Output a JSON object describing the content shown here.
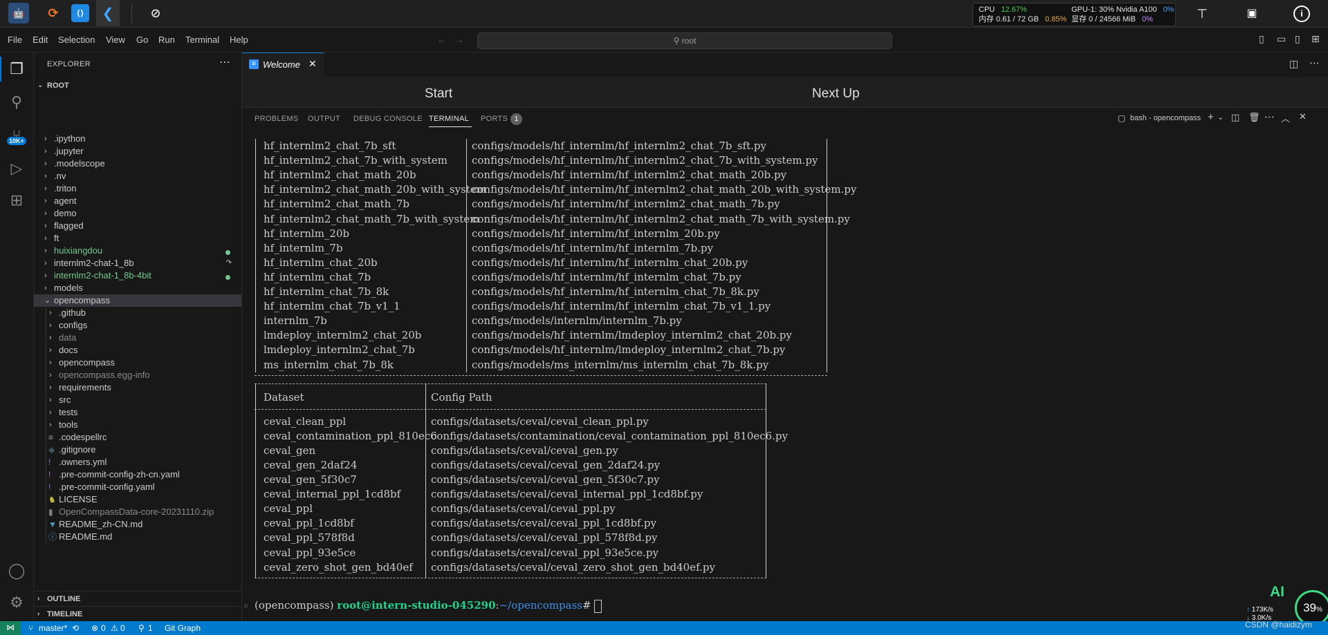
{
  "topbar": {
    "perf": {
      "cpu_label": "CPU",
      "cpu_value": "12.67%",
      "mem_label": "内存 0.61 / 72 GB",
      "mem_value": "0.85%",
      "gpu_label": "GPU-1: 30% Nvidia A100",
      "gpu_value": "0%",
      "vram_label": "显存 0 / 24566 MiB",
      "vram_value": "0%"
    }
  },
  "menubar": {
    "items": [
      "File",
      "Edit",
      "Selection",
      "View",
      "Go",
      "Run",
      "Terminal",
      "Help"
    ],
    "search_text": "root"
  },
  "activity": {
    "badge": "10K+"
  },
  "explorer": {
    "title": "EXPLORER",
    "root": "ROOT",
    "items": [
      {
        "label": ".ipython",
        "kind": "folder",
        "depth": 1,
        "color": "#cccccc"
      },
      {
        "label": ".jupyter",
        "kind": "folder",
        "depth": 1,
        "color": "#cccccc"
      },
      {
        "label": ".modelscope",
        "kind": "folder",
        "depth": 1,
        "color": "#cccccc"
      },
      {
        "label": ".nv",
        "kind": "folder",
        "depth": 1,
        "color": "#cccccc"
      },
      {
        "label": ".triton",
        "kind": "folder",
        "depth": 1,
        "color": "#cccccc"
      },
      {
        "label": "agent",
        "kind": "folder",
        "depth": 1,
        "color": "#cccccc"
      },
      {
        "label": "demo",
        "kind": "folder",
        "depth": 1,
        "color": "#cccccc"
      },
      {
        "label": "flagged",
        "kind": "folder",
        "depth": 1,
        "color": "#cccccc"
      },
      {
        "label": "ft",
        "kind": "folder",
        "depth": 1,
        "color": "#cccccc"
      },
      {
        "label": "huixiangdou",
        "kind": "folder",
        "depth": 1,
        "color": "#73c991",
        "dot": true
      },
      {
        "label": "internlm2-chat-1_8b",
        "kind": "folder",
        "depth": 1,
        "color": "#cccccc",
        "link": true
      },
      {
        "label": "internlm2-chat-1_8b-4bit",
        "kind": "folder",
        "depth": 1,
        "color": "#73c991",
        "dot": true
      },
      {
        "label": "models",
        "kind": "folder",
        "depth": 1,
        "color": "#cccccc"
      },
      {
        "label": "opencompass",
        "kind": "folder-open",
        "depth": 1,
        "color": "#cccccc"
      },
      {
        "label": ".github",
        "kind": "folder",
        "depth": 2,
        "color": "#cccccc"
      },
      {
        "label": "configs",
        "kind": "folder",
        "depth": 2,
        "color": "#cccccc"
      },
      {
        "label": "data",
        "kind": "folder",
        "depth": 2,
        "color": "#8b8b8b"
      },
      {
        "label": "docs",
        "kind": "folder",
        "depth": 2,
        "color": "#cccccc"
      },
      {
        "label": "opencompass",
        "kind": "folder",
        "depth": 2,
        "color": "#cccccc"
      },
      {
        "label": "opencompass.egg-info",
        "kind": "folder",
        "depth": 2,
        "color": "#8b8b8b"
      },
      {
        "label": "requirements",
        "kind": "folder",
        "depth": 2,
        "color": "#cccccc"
      },
      {
        "label": "src",
        "kind": "folder",
        "depth": 2,
        "color": "#cccccc"
      },
      {
        "label": "tests",
        "kind": "folder",
        "depth": 2,
        "color": "#cccccc"
      },
      {
        "label": "tools",
        "kind": "folder",
        "depth": 2,
        "color": "#cccccc"
      },
      {
        "label": ".codespellrc",
        "kind": "file",
        "depth": 2,
        "color": "#cccccc",
        "icon": "≡",
        "iconColor": "#9d9d9d"
      },
      {
        "label": ".gitignore",
        "kind": "file",
        "depth": 2,
        "color": "#cccccc",
        "icon": "◆",
        "iconColor": "#41535b"
      },
      {
        "label": ".owners.yml",
        "kind": "file",
        "depth": 2,
        "color": "#cccccc",
        "icon": "!",
        "iconColor": "#a074c4"
      },
      {
        "label": ".pre-commit-config-zh-cn.yaml",
        "kind": "file",
        "depth": 2,
        "color": "#cccccc",
        "icon": "!",
        "iconColor": "#a074c4"
      },
      {
        "label": ".pre-commit-config.yaml",
        "kind": "file",
        "depth": 2,
        "color": "#cccccc",
        "icon": "!",
        "iconColor": "#a074c4"
      },
      {
        "label": "LICENSE",
        "kind": "file",
        "depth": 2,
        "color": "#cccccc",
        "icon": "♞",
        "iconColor": "#cbcb41"
      },
      {
        "label": "OpenCompassData-core-20231110.zip",
        "kind": "file",
        "depth": 2,
        "color": "#8b8b8b",
        "icon": "▮",
        "iconColor": "#7f7f7f"
      },
      {
        "label": "README_zh-CN.md",
        "kind": "file",
        "depth": 2,
        "color": "#cccccc",
        "icon": "▼",
        "iconColor": "#519aba"
      },
      {
        "label": "README.md",
        "kind": "file",
        "depth": 2,
        "color": "#cccccc",
        "icon": "ⓘ",
        "iconColor": "#519aba"
      }
    ],
    "outline": "OUTLINE",
    "timeline": "TIMELINE"
  },
  "editor": {
    "tab_label": "Welcome",
    "start_heading": "Start",
    "next_heading": "Next Up"
  },
  "panel": {
    "tabs": [
      "PROBLEMS",
      "OUTPUT",
      "DEBUG CONSOLE",
      "TERMINAL",
      "PORTS"
    ],
    "ports_badge": "1",
    "terminal_name": "bash - opencompass"
  },
  "terminal": {
    "models": [
      [
        "hf_internlm2_chat_7b_sft",
        "configs/models/hf_internlm/hf_internlm2_chat_7b_sft.py"
      ],
      [
        "hf_internlm2_chat_7b_with_system",
        "configs/models/hf_internlm/hf_internlm2_chat_7b_with_system.py"
      ],
      [
        "hf_internlm2_chat_math_20b",
        "configs/models/hf_internlm/hf_internlm2_chat_math_20b.py"
      ],
      [
        "hf_internlm2_chat_math_20b_with_system",
        "configs/models/hf_internlm/hf_internlm2_chat_math_20b_with_system.py"
      ],
      [
        "hf_internlm2_chat_math_7b",
        "configs/models/hf_internlm/hf_internlm2_chat_math_7b.py"
      ],
      [
        "hf_internlm2_chat_math_7b_with_system",
        "configs/models/hf_internlm/hf_internlm2_chat_math_7b_with_system.py"
      ],
      [
        "hf_internlm_20b",
        "configs/models/hf_internlm/hf_internlm_20b.py"
      ],
      [
        "hf_internlm_7b",
        "configs/models/hf_internlm/hf_internlm_7b.py"
      ],
      [
        "hf_internlm_chat_20b",
        "configs/models/hf_internlm/hf_internlm_chat_20b.py"
      ],
      [
        "hf_internlm_chat_7b",
        "configs/models/hf_internlm/hf_internlm_chat_7b.py"
      ],
      [
        "hf_internlm_chat_7b_8k",
        "configs/models/hf_internlm/hf_internlm_chat_7b_8k.py"
      ],
      [
        "hf_internlm_chat_7b_v1_1",
        "configs/models/hf_internlm/hf_internlm_chat_7b_v1_1.py"
      ],
      [
        "internlm_7b",
        "configs/models/internlm/internlm_7b.py"
      ],
      [
        "lmdeploy_internlm2_chat_20b",
        "configs/models/hf_internlm/lmdeploy_internlm2_chat_20b.py"
      ],
      [
        "lmdeploy_internlm2_chat_7b",
        "configs/models/hf_internlm/lmdeploy_internlm2_chat_7b.py"
      ],
      [
        "ms_internlm_chat_7b_8k",
        "configs/models/ms_internlm/ms_internlm_chat_7b_8k.py"
      ]
    ],
    "dataset_header": [
      "Dataset",
      "Config Path"
    ],
    "datasets": [
      [
        "ceval_clean_ppl",
        "configs/datasets/ceval/ceval_clean_ppl.py"
      ],
      [
        "ceval_contamination_ppl_810ec6",
        "configs/datasets/contamination/ceval_contamination_ppl_810ec6.py"
      ],
      [
        "ceval_gen",
        "configs/datasets/ceval/ceval_gen.py"
      ],
      [
        "ceval_gen_2daf24",
        "configs/datasets/ceval/ceval_gen_2daf24.py"
      ],
      [
        "ceval_gen_5f30c7",
        "configs/datasets/ceval/ceval_gen_5f30c7.py"
      ],
      [
        "ceval_internal_ppl_1cd8bf",
        "configs/datasets/ceval/ceval_internal_ppl_1cd8bf.py"
      ],
      [
        "ceval_ppl",
        "configs/datasets/ceval/ceval_ppl.py"
      ],
      [
        "ceval_ppl_1cd8bf",
        "configs/datasets/ceval/ceval_ppl_1cd8bf.py"
      ],
      [
        "ceval_ppl_578f8d",
        "configs/datasets/ceval/ceval_ppl_578f8d.py"
      ],
      [
        "ceval_ppl_93e5ce",
        "configs/datasets/ceval/ceval_ppl_93e5ce.py"
      ],
      [
        "ceval_zero_shot_gen_bd40ef",
        "configs/datasets/ceval/ceval_zero_shot_gen_bd40ef.py"
      ]
    ],
    "prompt_env": "(opencompass)",
    "prompt_user": "root@intern-studio-045290",
    "prompt_path": "~/opencompass",
    "prompt_symbol": "#"
  },
  "statusbar": {
    "branch": "master*",
    "errors": "0",
    "warnings": "0",
    "ports": "1",
    "git_graph": "Git Graph",
    "net_speed": "173K/s",
    "net_speed2": "3.0K/s",
    "watermark": "CSDN @haidizym",
    "ai_label": "AI",
    "percent": "39"
  }
}
